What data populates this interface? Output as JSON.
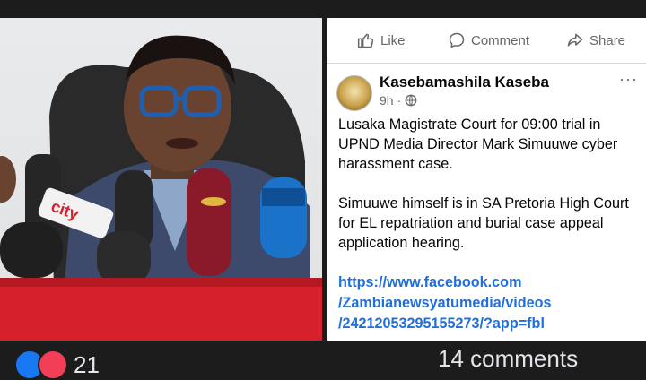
{
  "actions": {
    "like": "Like",
    "comment": "Comment",
    "share": "Share"
  },
  "post": {
    "author": "Kasebamashila Kaseba",
    "time": "9h",
    "more": "···",
    "paragraphs": [
      "Lusaka Magistrate Court for 09:00 trial in UPND Media Director Mark Simuuwe cyber harassment case.",
      "Simuuwe himself is in SA Pretoria High Court for EL repatriation and burial case appeal application hearing."
    ],
    "link_lines": [
      "https://www.facebook.com",
      "/Zambianewsyatumedia/videos",
      "/24212053295155273/?app=fbl"
    ]
  },
  "photo": {
    "mic_label": "city",
    "colors": {
      "red_table": "#d6202b",
      "maroon_mic": "#8a1a2a",
      "blue_mic": "#1a73c8"
    }
  },
  "footer": {
    "reaction_count": "21",
    "comments": "14 comments"
  },
  "colors": {
    "link": "#216fdb",
    "text": "#050505",
    "muted": "#65676b",
    "dark_bg": "#1c1c1c"
  }
}
